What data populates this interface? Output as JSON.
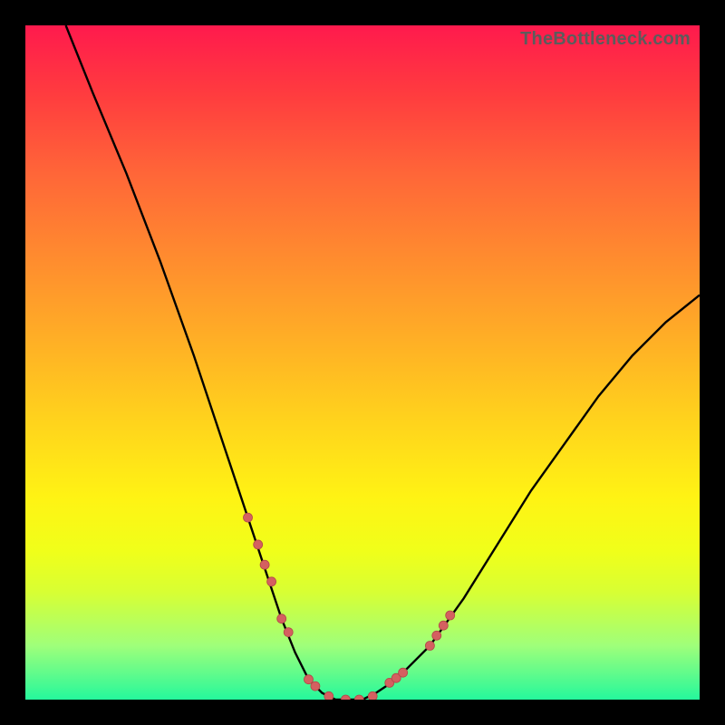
{
  "watermark": "TheBottleneck.com",
  "colors": {
    "background": "#000000",
    "gradient_top": "#ff1a4d",
    "gradient_bottom": "#25f89c",
    "curve": "#000000",
    "marker_fill": "#d46060",
    "marker_stroke": "#b24848"
  },
  "chart_data": {
    "type": "line",
    "title": "",
    "xlabel": "",
    "ylabel": "",
    "xlim": [
      0,
      100
    ],
    "ylim": [
      0,
      100
    ],
    "grid": false,
    "series": [
      {
        "name": "bottleneck-curve",
        "description": "V-shaped bottleneck curve; y=0 at the optimum, rising steeply either side",
        "x": [
          6,
          10,
          15,
          20,
          25,
          30,
          33,
          36,
          38,
          40,
          42,
          44,
          46,
          48,
          50,
          52,
          55,
          60,
          65,
          70,
          75,
          80,
          85,
          90,
          95,
          100
        ],
        "y": [
          100,
          90,
          78,
          65,
          51,
          36,
          27,
          18,
          12,
          7,
          3,
          1,
          0,
          0,
          0,
          1,
          3,
          8,
          15,
          23,
          31,
          38,
          45,
          51,
          56,
          60
        ]
      }
    ],
    "markers": {
      "name": "highlighted-points",
      "x": [
        33.0,
        34.5,
        35.5,
        36.5,
        38.0,
        39.0,
        42.0,
        43.0,
        45.0,
        47.5,
        49.5,
        51.5,
        54.0,
        55.0,
        56.0,
        60.0,
        61.0,
        62.0,
        63.0
      ],
      "y": [
        27.0,
        23.0,
        20.0,
        17.5,
        12.0,
        10.0,
        3.0,
        2.0,
        0.5,
        0.0,
        0.0,
        0.5,
        2.5,
        3.2,
        4.0,
        8.0,
        9.5,
        11.0,
        12.5
      ],
      "r": 5
    }
  }
}
